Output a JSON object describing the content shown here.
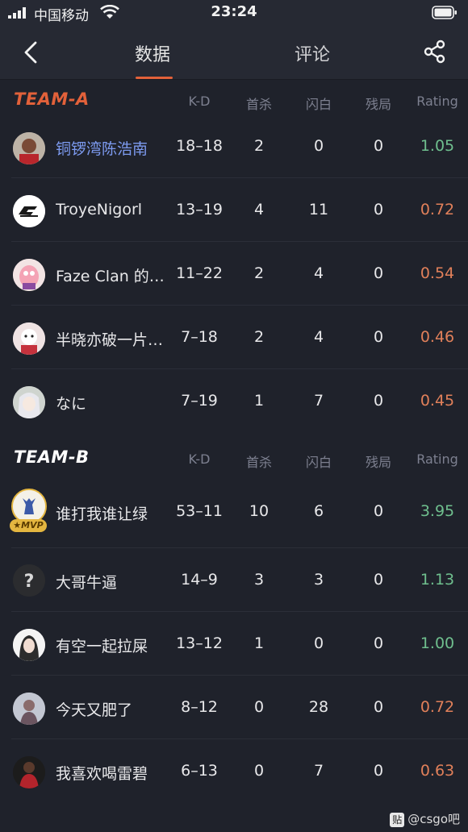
{
  "status_bar": {
    "carrier": "中国移动",
    "time": "23:24"
  },
  "nav": {
    "tabs": [
      "数据",
      "评论"
    ],
    "active_tab": "数据"
  },
  "columns": [
    "K-D",
    "首杀",
    "闪白",
    "残局",
    "Rating"
  ],
  "colors": {
    "accent": "#e2613a",
    "good": "#6fbf8e",
    "bad": "#e1805a",
    "player_highlight": "#7d9bf0"
  },
  "team_a": {
    "name": "TEAM-A",
    "players": [
      {
        "name": "铜锣湾陈浩南",
        "kd": "18–18",
        "first_kills": "2",
        "flashes": "0",
        "clutches": "0",
        "rating": "1.05"
      },
      {
        "name": "TroyeNigorl",
        "kd": "13–19",
        "first_kills": "4",
        "flashes": "11",
        "clutches": "0",
        "rating": "0.72"
      },
      {
        "name": "Faze Clan 的…",
        "kd": "11–22",
        "first_kills": "2",
        "flashes": "4",
        "clutches": "0",
        "rating": "0.54"
      },
      {
        "name": "半晓亦破一片…",
        "kd": "7–18",
        "first_kills": "2",
        "flashes": "4",
        "clutches": "0",
        "rating": "0.46"
      },
      {
        "name": "なに",
        "kd": "7–19",
        "first_kills": "1",
        "flashes": "7",
        "clutches": "0",
        "rating": "0.45"
      }
    ]
  },
  "team_b": {
    "name": "TEAM-B",
    "players": [
      {
        "name": "谁打我谁让绿",
        "kd": "53–11",
        "first_kills": "10",
        "flashes": "6",
        "clutches": "0",
        "rating": "3.95",
        "badge": "MVP"
      },
      {
        "name": "大哥牛逼",
        "kd": "14–9",
        "first_kills": "3",
        "flashes": "3",
        "clutches": "0",
        "rating": "1.13"
      },
      {
        "name": "有空一起拉屎",
        "kd": "13–12",
        "first_kills": "1",
        "flashes": "0",
        "clutches": "0",
        "rating": "1.00"
      },
      {
        "name": "今天又肥了",
        "kd": "8–12",
        "first_kills": "0",
        "flashes": "28",
        "clutches": "0",
        "rating": "0.72"
      },
      {
        "name": "我喜欢喝雷碧",
        "kd": "6–13",
        "first_kills": "0",
        "flashes": "7",
        "clutches": "0",
        "rating": "0.63"
      }
    ]
  },
  "watermark": {
    "icon": "贴",
    "text": "@csgo吧"
  }
}
